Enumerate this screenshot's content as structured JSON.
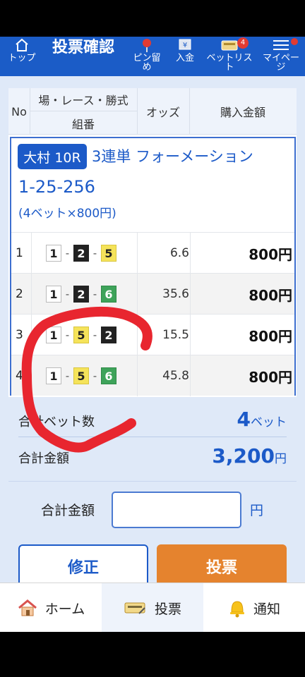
{
  "header": {
    "title": "投票確認",
    "nav": [
      {
        "label": "トップ",
        "icon": "home-outline-icon"
      },
      {
        "label": "ピン留め",
        "icon": "pin-icon"
      },
      {
        "label": "入金",
        "icon": "deposit-icon"
      },
      {
        "label": "ベットリスト",
        "icon": "bet-list-icon",
        "badge": "4"
      },
      {
        "label": "マイページ",
        "icon": "menu-icon"
      }
    ]
  },
  "table": {
    "headers": {
      "no": "No",
      "race": "場・レース・勝式",
      "combo": "組番",
      "odds": "オッズ",
      "amount": "購入金額"
    }
  },
  "bet": {
    "place": "大村 10R",
    "type": "3連単 フォーメーション",
    "combination": "1-25-256",
    "detail": "(4ベット×800円)",
    "rows": [
      {
        "no": "1",
        "boats": [
          "1",
          "2",
          "5"
        ],
        "odds": "6.6",
        "amount": "800円"
      },
      {
        "no": "2",
        "boats": [
          "1",
          "2",
          "6"
        ],
        "odds": "35.6",
        "amount": "800円"
      },
      {
        "no": "3",
        "boats": [
          "1",
          "5",
          "2"
        ],
        "odds": "15.5",
        "amount": "800円"
      },
      {
        "no": "4",
        "boats": [
          "1",
          "5",
          "6"
        ],
        "odds": "45.8",
        "amount": "800円"
      }
    ]
  },
  "totals": {
    "bet_count_label": "合計ベット数",
    "bet_count": "4",
    "bet_count_unit": "ベット",
    "amount_label": "合計金額",
    "amount": "3,200",
    "amount_unit": "円"
  },
  "confirm": {
    "label": "合計金額",
    "value": "",
    "unit": "円"
  },
  "buttons": {
    "fix": "修正",
    "vote": "投票"
  },
  "tabbar": [
    {
      "label": "ホーム",
      "icon": "home-icon"
    },
    {
      "label": "投票",
      "icon": "ticket-icon",
      "active": true
    },
    {
      "label": "通知",
      "icon": "bell-icon"
    }
  ],
  "colors": {
    "brand": "#1b5cc7",
    "accent": "#e5832e",
    "annotation": "#e8262f"
  }
}
